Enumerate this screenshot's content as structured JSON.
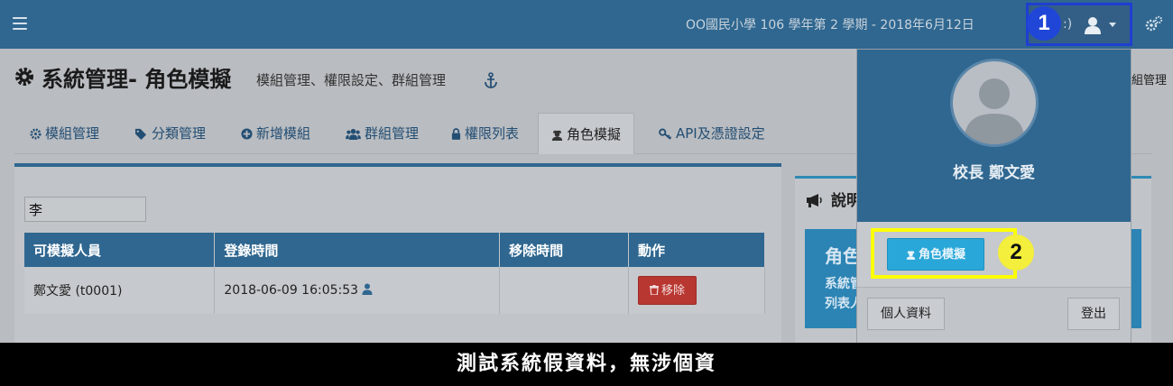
{
  "navbar": {
    "school_term": "OO國民小學 106 學年第 2 學期 - 2018年6月12日",
    "user_paren": ":)",
    "callout_1": "1",
    "menu_icon": "hamburger-icon",
    "user_icon": "user-icon",
    "settings_icon": "cogs-icon",
    "color": "#2f6790"
  },
  "header": {
    "title": "系統管理- 角色模擬",
    "subtitle": "模組管理、權限設定、群組管理",
    "right_clip": "組管理",
    "title_icon": "gear-icon",
    "anchor_icon": "anchor-icon"
  },
  "tabs": [
    {
      "label": "模組管理",
      "icon": "gear-icon"
    },
    {
      "label": "分類管理",
      "icon": "tags-icon"
    },
    {
      "label": "新增模組",
      "icon": "plus-circle-icon"
    },
    {
      "label": "群組管理",
      "icon": "users-icon"
    },
    {
      "label": "權限列表",
      "icon": "lock-icon"
    },
    {
      "label": "角色模擬",
      "icon": "user-secret-icon"
    },
    {
      "label": "API及憑證設定",
      "icon": "key-icon"
    }
  ],
  "active_tab": "角色模擬",
  "filter": {
    "value": "李"
  },
  "table": {
    "columns": [
      "可模擬人員",
      "登錄時間",
      "移除時間",
      "動作"
    ],
    "rows": [
      {
        "name": "鄭文愛 (t0001)",
        "login_time": "2018-06-09 16:05:53",
        "remove_time": "",
        "action": "移除"
      }
    ]
  },
  "info_panel": {
    "heading": "說明",
    "box_title": "角色",
    "box_line1": "系統管",
    "box_line2": "列表人",
    "heading_icon": "bullhorn-icon"
  },
  "dropdown": {
    "user_name": "校長 鄭文愛",
    "role_button": "角色模擬",
    "profile_button": "個人資料",
    "logout_button": "登出",
    "callout_2": "2",
    "avatar_icon": "avatar-placeholder"
  },
  "caption": "測試系統假資料，無涉個資",
  "colors": {
    "primary": "#2f6790",
    "danger": "#b93731",
    "info": "#2aa7d9",
    "callout_blue": "#2046d8",
    "callout_yellow": "#ffff00"
  }
}
